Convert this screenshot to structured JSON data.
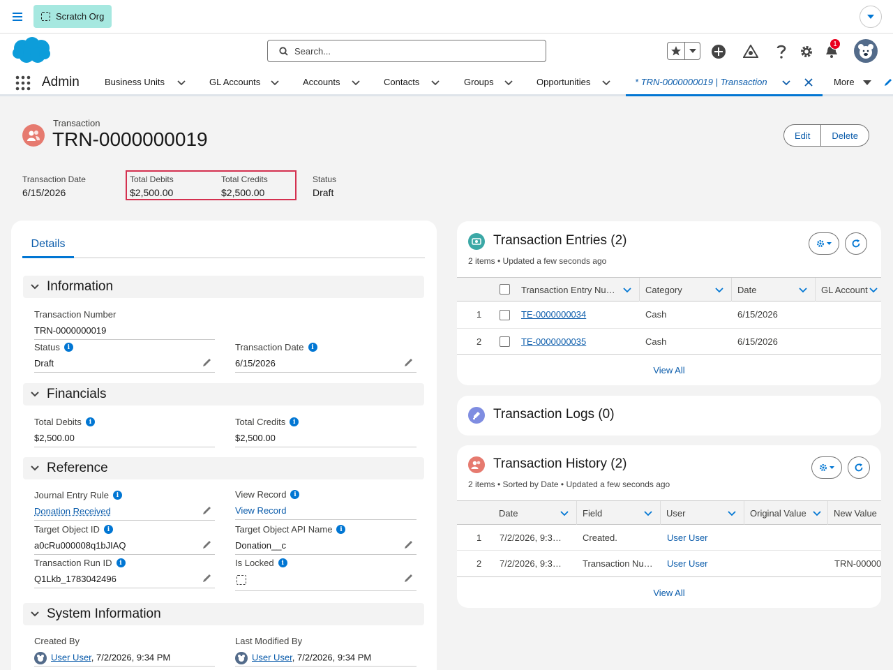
{
  "topbar": {
    "org_label": "Scratch Org"
  },
  "header": {
    "search_placeholder": "Search...",
    "notification_count": "1"
  },
  "nav": {
    "app_name": "Admin",
    "items": [
      "Business Units",
      "GL Accounts",
      "Accounts",
      "Contacts",
      "Groups",
      "Opportunities"
    ],
    "active_tab": "* TRN-0000000019 | Transaction",
    "more_label": "More"
  },
  "record": {
    "type_label": "Transaction",
    "title": "TRN-0000000019",
    "edit_label": "Edit",
    "delete_label": "Delete",
    "highlights": [
      {
        "label": "Transaction Date",
        "value": "6/15/2026"
      },
      {
        "label": "Total Debits",
        "value": "$2,500.00"
      },
      {
        "label": "Total Credits",
        "value": "$2,500.00"
      },
      {
        "label": "Status",
        "value": "Draft"
      }
    ]
  },
  "details": {
    "tab_label": "Details",
    "sections": {
      "information": "Information",
      "financials": "Financials",
      "reference": "Reference",
      "system": "System Information"
    },
    "fields": {
      "transaction_number": {
        "label": "Transaction Number",
        "value": "TRN-0000000019"
      },
      "status": {
        "label": "Status",
        "value": "Draft"
      },
      "transaction_date": {
        "label": "Transaction Date",
        "value": "6/15/2026"
      },
      "total_debits": {
        "label": "Total Debits",
        "value": "$2,500.00"
      },
      "total_credits": {
        "label": "Total Credits",
        "value": "$2,500.00"
      },
      "journal_entry_rule": {
        "label": "Journal Entry Rule",
        "value": "Donation Received"
      },
      "view_record": {
        "label": "View Record",
        "value": "View Record"
      },
      "target_object_id": {
        "label": "Target Object ID",
        "value": "a0cRu000008q1bJIAQ"
      },
      "target_object_api_name": {
        "label": "Target Object API Name",
        "value": "Donation__c"
      },
      "transaction_run_id": {
        "label": "Transaction Run ID",
        "value": "Q1Lkb_1783042496"
      },
      "is_locked": {
        "label": "Is Locked"
      },
      "created_by": {
        "label": "Created By",
        "user": "User User",
        "timestamp": ", 7/2/2026, 9:34 PM"
      },
      "last_modified_by": {
        "label": "Last Modified By",
        "user": "User User",
        "timestamp": ", 7/2/2026, 9:34 PM"
      }
    }
  },
  "entries": {
    "title": "Transaction Entries (2)",
    "subtitle": "2 items • Updated a few seconds ago",
    "columns": [
      "Transaction Entry Nu…",
      "Category",
      "Date",
      "GL Account"
    ],
    "rows": [
      {
        "num": "1",
        "entry": "TE-0000000034",
        "category": "Cash",
        "date": "6/15/2026"
      },
      {
        "num": "2",
        "entry": "TE-0000000035",
        "category": "Cash",
        "date": "6/15/2026"
      }
    ],
    "view_all": "View All"
  },
  "logs": {
    "title": "Transaction Logs (0)"
  },
  "history": {
    "title": "Transaction History (2)",
    "subtitle": "2 items • Sorted by Date • Updated a few seconds ago",
    "columns": [
      "Date",
      "Field",
      "User",
      "Original Value",
      "New Value"
    ],
    "rows": [
      {
        "num": "1",
        "date": "7/2/2026, 9:3…",
        "field": "Created.",
        "user": "User User",
        "original": "",
        "new": ""
      },
      {
        "num": "2",
        "date": "7/2/2026, 9:3…",
        "field": "Transaction Nu…",
        "user": "User User",
        "original": "",
        "new": "TRN-00000"
      }
    ],
    "view_all": "View All"
  },
  "colors": {
    "brand_blue": "#0176d3",
    "link_blue": "#0b5cab",
    "highlight_red": "#d4304f",
    "org_teal": "#a6e8e0"
  }
}
